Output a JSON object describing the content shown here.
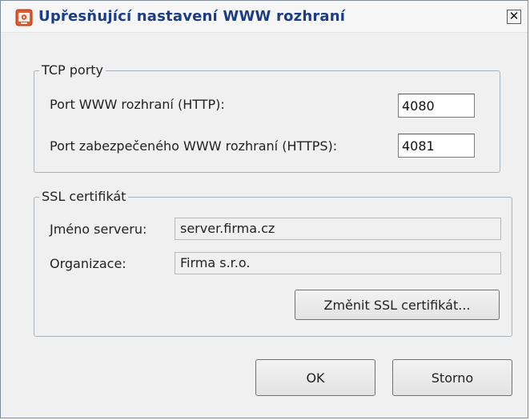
{
  "window": {
    "title": "Upřesňující nastavení WWW rozhraní",
    "close_glyph": "✕",
    "icon": "settings-app-icon"
  },
  "tcp_ports": {
    "legend": "TCP porty",
    "http_label": "Port WWW rozhraní (HTTP):",
    "http_value": "4080",
    "https_label": "Port zabezpečeného WWW rozhraní (HTTPS):",
    "https_value": "4081"
  },
  "ssl": {
    "legend": "SSL certifikát",
    "server_label": "Jméno serveru:",
    "server_value": "server.firma.cz",
    "org_label": "Organizace:",
    "org_value": "Firma s.r.o.",
    "change_button": "Změnit SSL certifikát..."
  },
  "buttons": {
    "ok": "OK",
    "cancel": "Storno"
  }
}
